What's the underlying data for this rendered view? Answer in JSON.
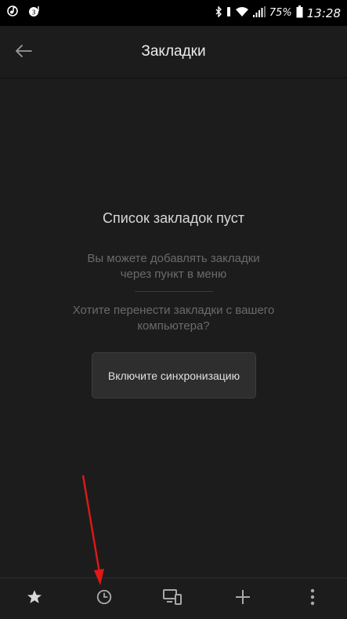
{
  "status_bar": {
    "battery_percent": "75%",
    "time": "13:28",
    "icons": [
      "music-note-icon",
      "notification-icon",
      "bluetooth-icon",
      "vibrate-icon",
      "wifi-icon",
      "signal-icon",
      "battery-icon"
    ]
  },
  "app_bar": {
    "title": "Закладки",
    "back_icon": "arrow-left-icon"
  },
  "empty_state": {
    "title": "Список закладок пуст",
    "hint_line1": "Вы можете добавлять закладки",
    "hint_line2": "через пункт в меню",
    "question_line1": "Хотите перенести закладки с вашего",
    "question_line2": "компьютера?",
    "sync_button_label": "Включите синхронизацию"
  },
  "bottom_nav": {
    "items": [
      "star-icon",
      "clock-icon",
      "devices-icon",
      "plus-icon",
      "more-vert-icon"
    ]
  },
  "colors": {
    "background": "#1c1c1c",
    "status_bar": "#000000",
    "annotation": "#e01818"
  }
}
